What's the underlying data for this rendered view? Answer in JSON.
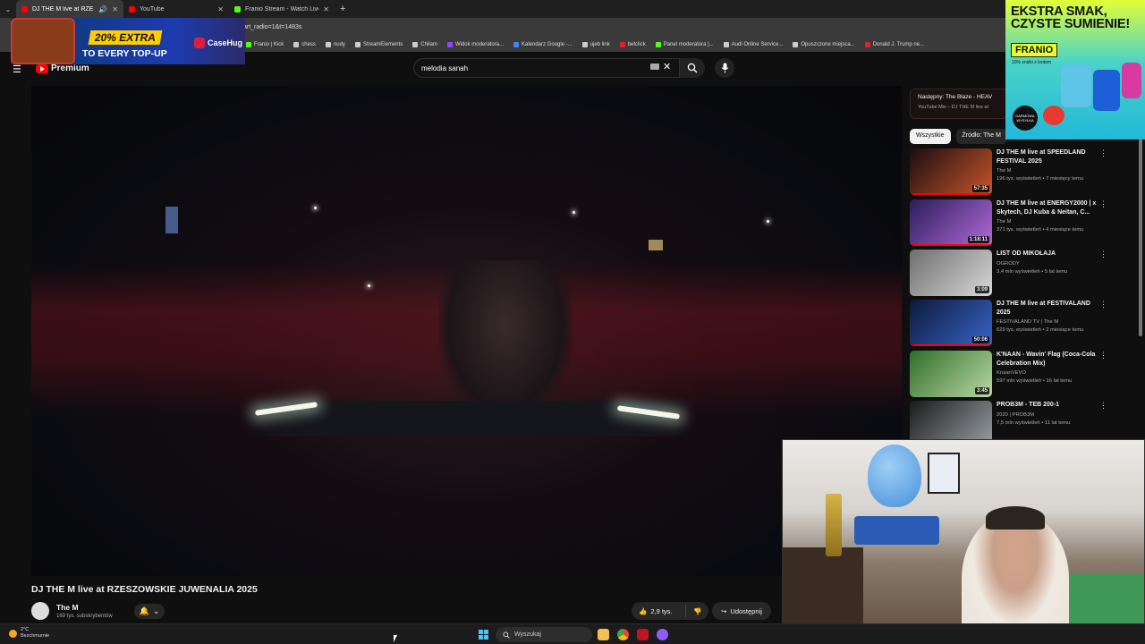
{
  "browser": {
    "tabs": [
      {
        "title": "DJ THE M live at RZESZOW",
        "active": true,
        "icon": "youtube-icon",
        "color": "#ff0000"
      },
      {
        "title": "YouTube",
        "active": false,
        "icon": "youtube-icon",
        "color": "#ff0000"
      },
      {
        "title": "Franio Stream - Watch Live on",
        "active": false,
        "icon": "kick-icon",
        "color": "#53fc18"
      }
    ],
    "url_fragment": "art_radio=1&t=1483s",
    "bookmarks": [
      {
        "label": "Franio | Kick",
        "color": "#53fc18"
      },
      {
        "label": "chess",
        "color": "#cccccc"
      },
      {
        "label": "nudy",
        "color": "#cccccc"
      },
      {
        "label": "StreamElements",
        "color": "#cccccc"
      },
      {
        "label": "Chilam",
        "color": "#cccccc"
      },
      {
        "label": "Widok moderatora...",
        "color": "#9146ff"
      },
      {
        "label": "Kalendarz Google -...",
        "color": "#4285f4"
      },
      {
        "label": "ujeb link",
        "color": "#cccccc"
      },
      {
        "label": "betclick",
        "color": "#e0202e"
      },
      {
        "label": "Panel moderatora |...",
        "color": "#53fc18"
      },
      {
        "label": "Audi Online Service...",
        "color": "#cccccc"
      },
      {
        "label": "Opuszczone miejsca...",
        "color": "#cccccc"
      },
      {
        "label": "Donald J. Trump ne...",
        "color": "#e0202e"
      }
    ]
  },
  "youtube": {
    "logo_text": "Premium",
    "search_value": "melodia sanah",
    "video_title": "DJ THE M live at RZESZOWSKIE JUWENALIA 2025",
    "channel_name": "The M",
    "channel_subs": "169 tys. subskrybentów",
    "likes": "2,9 tys.",
    "share_label": "Udostępnij",
    "up_next_label": "Następny: The Blaze - HEAV",
    "up_next_sub": "YouTube Mix – DJ THE M live at",
    "chips": [
      "Wszystkie",
      "Źródło: The M"
    ],
    "sidebar": [
      {
        "title": "DJ THE M live at SPEEDLAND FESTIVAL 2025",
        "channel": "The M",
        "stats": "196 tys. wyświetleń • 7 miesięcy temu",
        "duration": "57:35",
        "progress": 1.0,
        "colors": [
          "#1a0c10",
          "#c8552a"
        ]
      },
      {
        "title": "DJ THE M live at ENERGY2000 | x Skytech, DJ Kuba & Neitan, C...",
        "channel": "The M",
        "stats": "371 tys. wyświetleń • 4 miesiące temu",
        "duration": "1:18:11",
        "progress": 1.0,
        "colors": [
          "#2b1d5a",
          "#b06ad8"
        ]
      },
      {
        "title": "LIST OD MIKOŁAJA",
        "channel": "OGRODY",
        "stats": "3,4 mln wyświetleń • 5 lat temu",
        "duration": "3:09",
        "progress": 0,
        "colors": [
          "#6e6e6e",
          "#d9d9d9"
        ]
      },
      {
        "title": "DJ THE M live at FESTIVALAND 2025",
        "channel": "FESTIVALAND TV | The M",
        "stats": "629 tys. wyświetleń • 2 miesiące temu",
        "duration": "50:06",
        "progress": 1.0,
        "colors": [
          "#0c1a3a",
          "#3a63c8"
        ]
      },
      {
        "title": "K'NAAN - Wavin' Flag (Coca-Cola Celebration Mix)",
        "channel": "KnaanVEVO",
        "stats": "597 mln wyświetleń • 16 lat temu",
        "duration": "3:45",
        "progress": 0,
        "colors": [
          "#2f6e2a",
          "#b9d7a5"
        ]
      },
      {
        "title": "PROB3M - TEB 200-1",
        "channel": "2020 | PROB3M",
        "stats": "7,5 mln wyświetleń • 11 lat temu",
        "duration": "",
        "progress": 0,
        "colors": [
          "#1a1a1a",
          "#9aa0a6"
        ]
      }
    ]
  },
  "ads": {
    "casehug": {
      "percent": "20% EXTRA",
      "tagline": "TO EVERY TOP-UP",
      "brand": "CaseHug"
    },
    "franio": {
      "headline1": "EKSTRA SMAK,",
      "headline2": "CZYSTE SUMIENIE!",
      "brand": "FRANIO",
      "subtitle": "10% zniżki z kodem",
      "badge": "DARMOWA WYSYŁKA"
    }
  },
  "taskbar": {
    "temp": "2°C",
    "weather": "Bezchmurnie",
    "search_label": "Wyszukaj"
  }
}
